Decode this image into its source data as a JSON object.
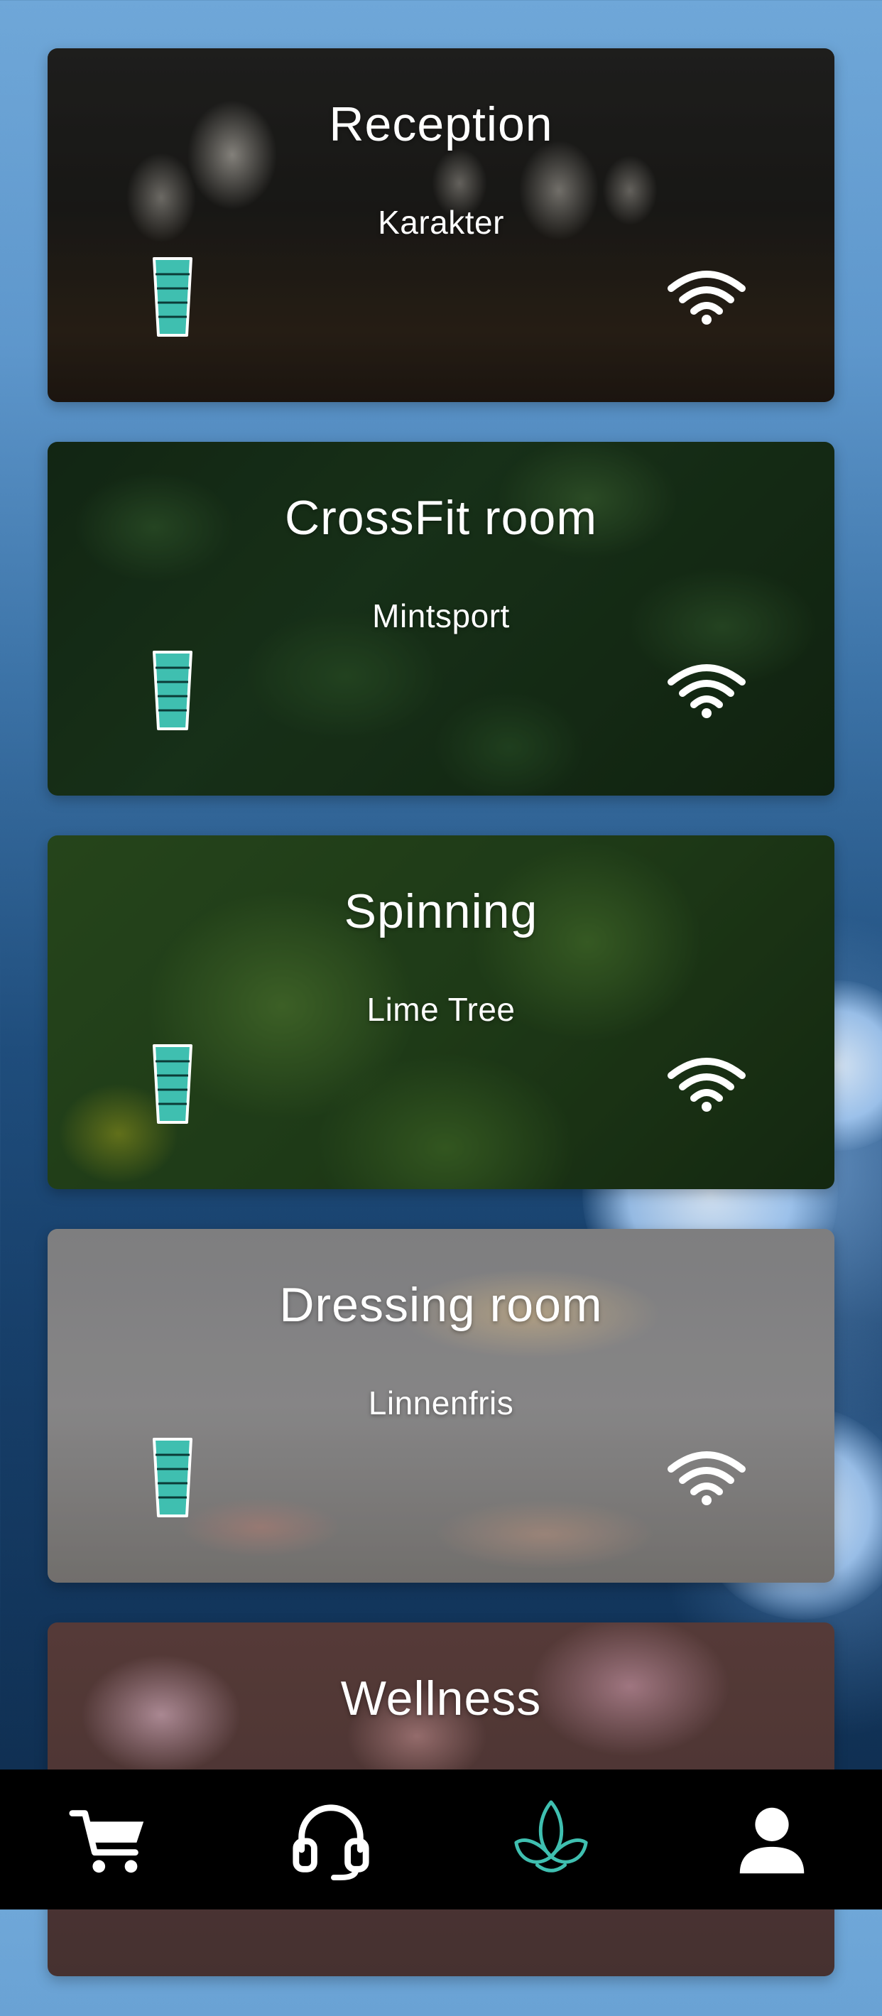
{
  "rooms": [
    {
      "title": "Reception",
      "subtitle": "Karakter",
      "theme": "gallery"
    },
    {
      "title": "CrossFit room",
      "subtitle": "Mintsport",
      "theme": "leaves"
    },
    {
      "title": "Spinning",
      "subtitle": "Lime Tree",
      "theme": "limes"
    },
    {
      "title": "Dressing room",
      "subtitle": "Linnenfris",
      "theme": "laundry"
    },
    {
      "title": "Wellness",
      "subtitle": "",
      "theme": "blossom"
    }
  ],
  "icons": {
    "level": "fill-level-icon",
    "wifi": "wifi-icon"
  },
  "bottom_nav": [
    {
      "icon": "cart-icon",
      "active": false
    },
    {
      "icon": "headset-icon",
      "active": false
    },
    {
      "icon": "lotus-icon",
      "active": true
    },
    {
      "icon": "person-icon",
      "active": false
    }
  ],
  "colors": {
    "accent": "#3fbfb0",
    "nav_background": "#000000",
    "text": "#ffffff"
  }
}
